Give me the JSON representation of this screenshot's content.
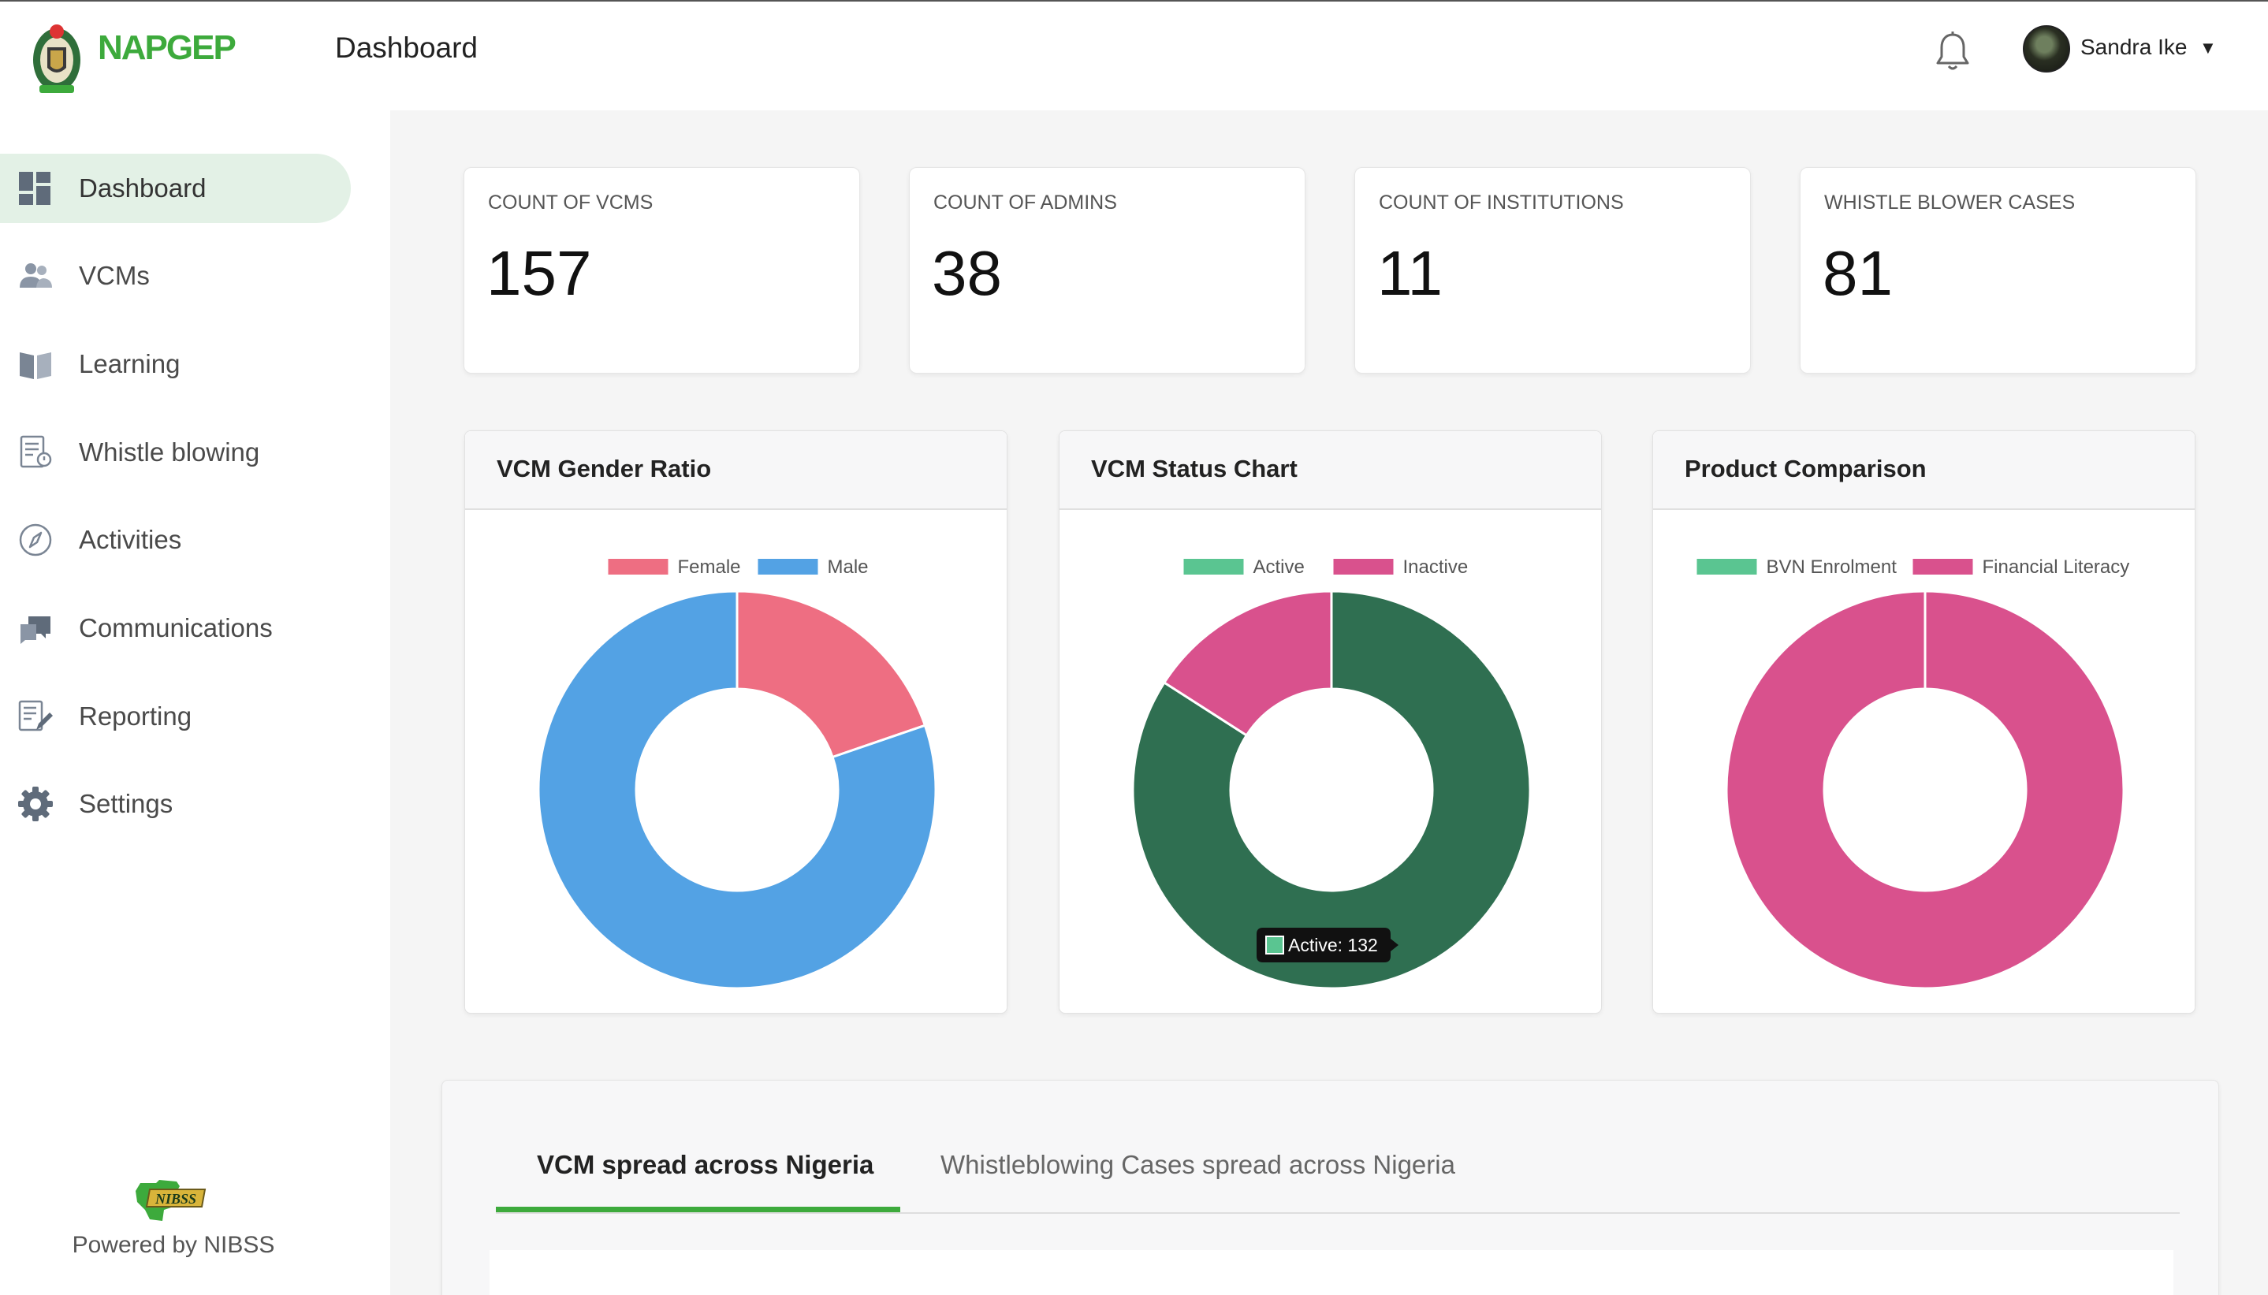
{
  "header": {
    "brand": "NAPGEP",
    "page_title": "Dashboard",
    "user_name": "Sandra Ike"
  },
  "sidebar": {
    "items": [
      {
        "label": "Dashboard",
        "icon": "dashboard-icon",
        "active": true
      },
      {
        "label": "VCMs",
        "icon": "users-icon"
      },
      {
        "label": "Learning",
        "icon": "book-icon"
      },
      {
        "label": "Whistle blowing",
        "icon": "report-document-icon"
      },
      {
        "label": "Activities",
        "icon": "compass-icon"
      },
      {
        "label": "Communications",
        "icon": "chat-icon"
      },
      {
        "label": "Reporting",
        "icon": "edit-document-icon"
      },
      {
        "label": "Settings",
        "icon": "gear-icon"
      }
    ],
    "footer_logo_text": "NIBSS",
    "footer_text": "Powered by NIBSS"
  },
  "stats": [
    {
      "label": "COUNT OF VCMS",
      "value": "157"
    },
    {
      "label": "COUNT OF ADMINS",
      "value": "38"
    },
    {
      "label": "COUNT OF INSTITUTIONS",
      "value": "11"
    },
    {
      "label": "WHISTLE BLOWER CASES",
      "value": "81"
    }
  ],
  "chart_data": [
    {
      "type": "pie",
      "variant": "doughnut",
      "title": "VCM Gender Ratio",
      "legend_position": "top",
      "categories": [
        "Female",
        "Male"
      ],
      "values": [
        31,
        126
      ],
      "colors": [
        "#ee6e82",
        "#53a2e4"
      ]
    },
    {
      "type": "pie",
      "variant": "doughnut",
      "title": "VCM Status Chart",
      "legend_position": "top",
      "categories": [
        "Active",
        "Inactive"
      ],
      "values": [
        132,
        25
      ],
      "colors": [
        "#2f6f51",
        "#d9518d"
      ],
      "legend_colors": [
        "#5ac591",
        "#d9518d"
      ],
      "tooltip": "Active: 132"
    },
    {
      "type": "pie",
      "variant": "doughnut",
      "title": "Product Comparison",
      "legend_position": "top",
      "categories": [
        "BVN Enrolment",
        "Financial Literacy"
      ],
      "values": [
        0,
        100
      ],
      "colors": [
        "#5ac591",
        "#d9518d"
      ]
    }
  ],
  "tabs": [
    {
      "label": "VCM spread across Nigeria",
      "active": true
    },
    {
      "label": "Whistleblowing Cases spread across Nigeria",
      "active": false
    }
  ],
  "colors": {
    "accent": "#3daa3c",
    "active_nav_bg": "#e3f1e6"
  }
}
